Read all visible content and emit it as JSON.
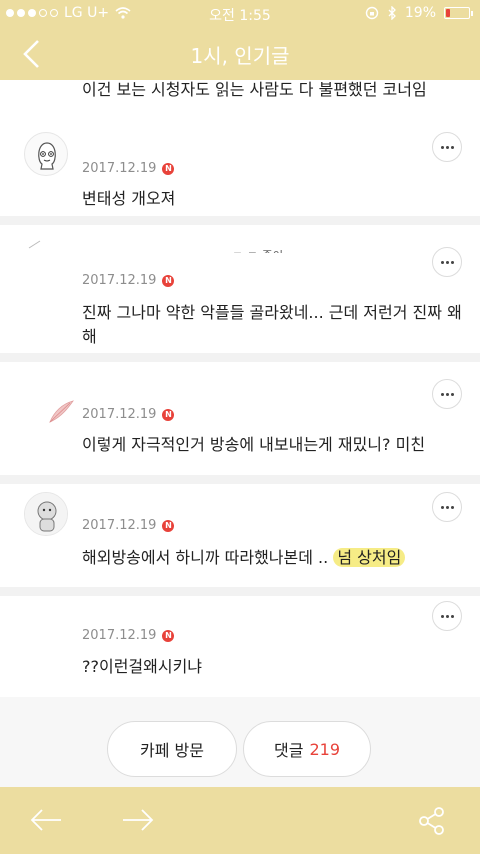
{
  "status": {
    "carrier": "LG U+",
    "time": "오전 1:55",
    "battery": "19%",
    "battery_level": 0.19
  },
  "nav": {
    "title": "1시, 인기글"
  },
  "top_clipped": "이건 보는 시청자도 읽는 사람도 다 불편했던 코너임",
  "comments": [
    {
      "date": "2017.12.19",
      "badge": "N",
      "text": "변태성 개오져"
    },
    {
      "date": "2017.12.19",
      "badge": "N",
      "text": "진짜 그나마 약한 악플들 골라왔네... 근데 저런거 진짜 왜해",
      "name_clip": "ㄱ ㄹ  좋아"
    },
    {
      "date": "2017.12.19",
      "badge": "N",
      "text": "이렇게 자극적인거 방송에 내보내는게 재밌니? 미친"
    },
    {
      "date": "2017.12.19",
      "badge": "N",
      "text_before": "해외방송에서 하니까 따라했나본데 ..",
      "text_highlight": "넘 상처임"
    },
    {
      "date": "2017.12.19",
      "badge": "N",
      "text": "??이런걸왜시키냐"
    }
  ],
  "buttons": {
    "visit_cafe": "카페 방문",
    "comments_label": "댓글",
    "comments_count": "219"
  }
}
